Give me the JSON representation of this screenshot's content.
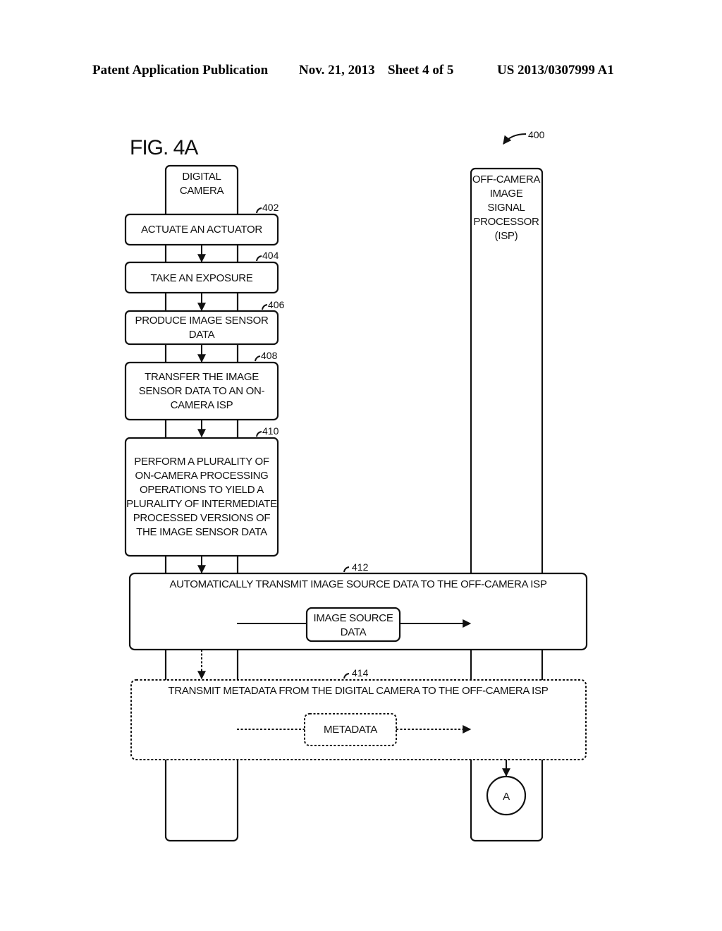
{
  "header": {
    "publication": "Patent Application Publication",
    "date": "Nov. 21, 2013",
    "sheet": "Sheet 4 of 5",
    "number": "US 2013/0307999 A1"
  },
  "figure": {
    "title": "FIG. 4A",
    "ref": "400",
    "lanes": {
      "camera": {
        "label_lines": [
          "DIGITAL",
          "CAMERA"
        ]
      },
      "isp": {
        "label_lines": [
          "OFF-CAMERA",
          "IMAGE",
          "SIGNAL",
          "PROCESSOR",
          "(ISP)"
        ]
      }
    },
    "steps": [
      {
        "ref": "402",
        "lines": [
          "ACTUATE AN ACTUATOR"
        ]
      },
      {
        "ref": "404",
        "lines": [
          "TAKE AN EXPOSURE"
        ]
      },
      {
        "ref": "406",
        "lines": [
          "PRODUCE IMAGE SENSOR",
          "DATA"
        ]
      },
      {
        "ref": "408",
        "lines": [
          "TRANSFER THE IMAGE",
          "SENSOR DATA TO AN ON-",
          "CAMERA ISP"
        ]
      },
      {
        "ref": "410",
        "lines": [
          "PERFORM A PLURALITY OF",
          "ON-CAMERA PROCESSING",
          "OPERATIONS TO YIELD A",
          "PLURALITY OF INTERMEDIATE",
          "PROCESSED VERSIONS OF",
          "THE IMAGE SENSOR DATA"
        ]
      }
    ],
    "transfers": [
      {
        "ref": "412",
        "title": "AUTOMATICALLY TRANSMIT IMAGE SOURCE DATA TO THE OFF-CAMERA ISP",
        "payload_lines": [
          "IMAGE SOURCE",
          "DATA"
        ],
        "style": "solid"
      },
      {
        "ref": "414",
        "title": "TRANSMIT METADATA FROM THE DIGITAL CAMERA TO THE OFF-CAMERA ISP",
        "payload_lines": [
          "METADATA"
        ],
        "style": "dashed"
      }
    ],
    "connector": "A"
  }
}
